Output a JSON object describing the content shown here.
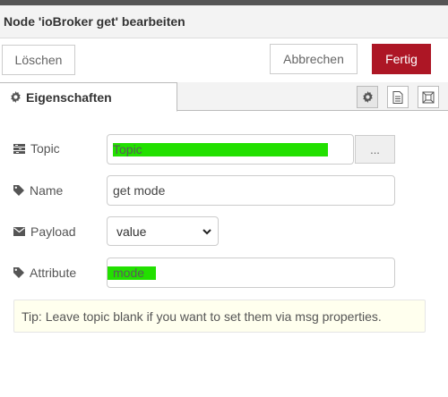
{
  "header": {
    "title": "Node 'ioBroker get' bearbeiten"
  },
  "buttons": {
    "delete": "Löschen",
    "cancel": "Abbrechen",
    "done": "Fertig"
  },
  "tabs": {
    "active_label": "Eigenschaften",
    "icons": [
      "gear-icon",
      "document-icon",
      "frame-icon"
    ]
  },
  "form": {
    "topic": {
      "label": "Topic",
      "value": "Topic",
      "browse": "..."
    },
    "name": {
      "label": "Name",
      "value": "get mode"
    },
    "payload": {
      "label": "Payload",
      "selected": "value"
    },
    "attribute": {
      "label": "Attribute",
      "value": "mode"
    }
  },
  "tip": "Tip: Leave topic blank if you want to set them via msg properties.",
  "colors": {
    "accent": "#ad1625",
    "highlight": "#22e000",
    "tip_bg": "#ffffee"
  }
}
